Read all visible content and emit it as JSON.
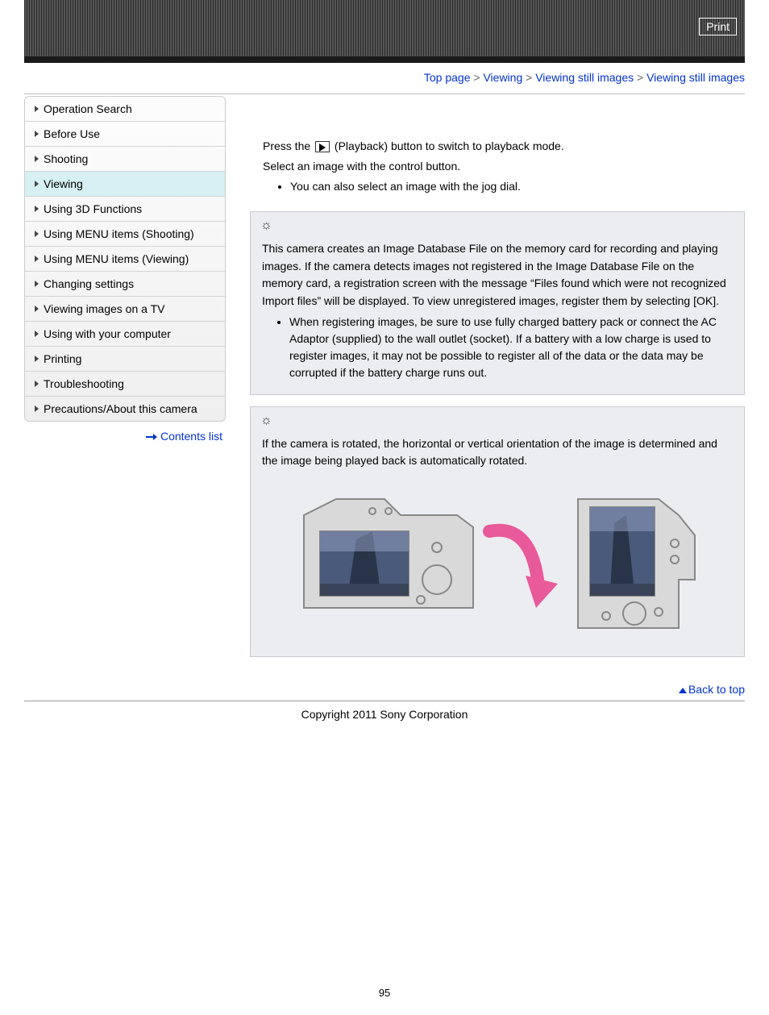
{
  "header": {
    "print": "Print"
  },
  "breadcrumb": {
    "top": "Top page",
    "sep": ">",
    "viewing": "Viewing",
    "still": "Viewing still images",
    "current": "Viewing still images"
  },
  "sidebar": {
    "items": [
      {
        "label": "Operation Search"
      },
      {
        "label": "Before Use"
      },
      {
        "label": "Shooting"
      },
      {
        "label": "Viewing",
        "active": true
      },
      {
        "label": "Using 3D Functions"
      },
      {
        "label": "Using MENU items (Shooting)"
      },
      {
        "label": "Using MENU items (Viewing)"
      },
      {
        "label": "Changing settings"
      },
      {
        "label": "Viewing images on a TV"
      },
      {
        "label": "Using with your computer"
      },
      {
        "label": "Printing"
      },
      {
        "label": "Troubleshooting"
      },
      {
        "label": "Precautions/About this camera"
      }
    ],
    "contents_link": "Contents list"
  },
  "content": {
    "press_before": "Press the ",
    "press_after": "(Playback) button to switch to playback mode.",
    "select": "Select an image with the control button.",
    "select_bullet": "You can also select an image with the jog dial.",
    "tip1_text": "This camera creates an Image Database File on the memory card for recording and playing images. If the camera detects images not registered in the Image Database File on the memory card, a registration screen with the message “Files found which were not recognized Import files” will be displayed. To view unregistered images, register them by selecting [OK].",
    "tip1_bullet": "When registering images, be sure to use fully charged battery pack or connect the AC Adaptor (supplied) to the wall outlet (socket). If a battery with a low charge is used to register images, it may not be possible to register all of the data or the data may be corrupted if the battery charge runs out.",
    "tip2_text": "If the camera is rotated, the horizontal or vertical orientation of the image is determined and the image being played back is automatically rotated."
  },
  "footer": {
    "back_to_top": "Back to top",
    "copyright": "Copyright 2011 Sony Corporation",
    "page_num": "95"
  }
}
